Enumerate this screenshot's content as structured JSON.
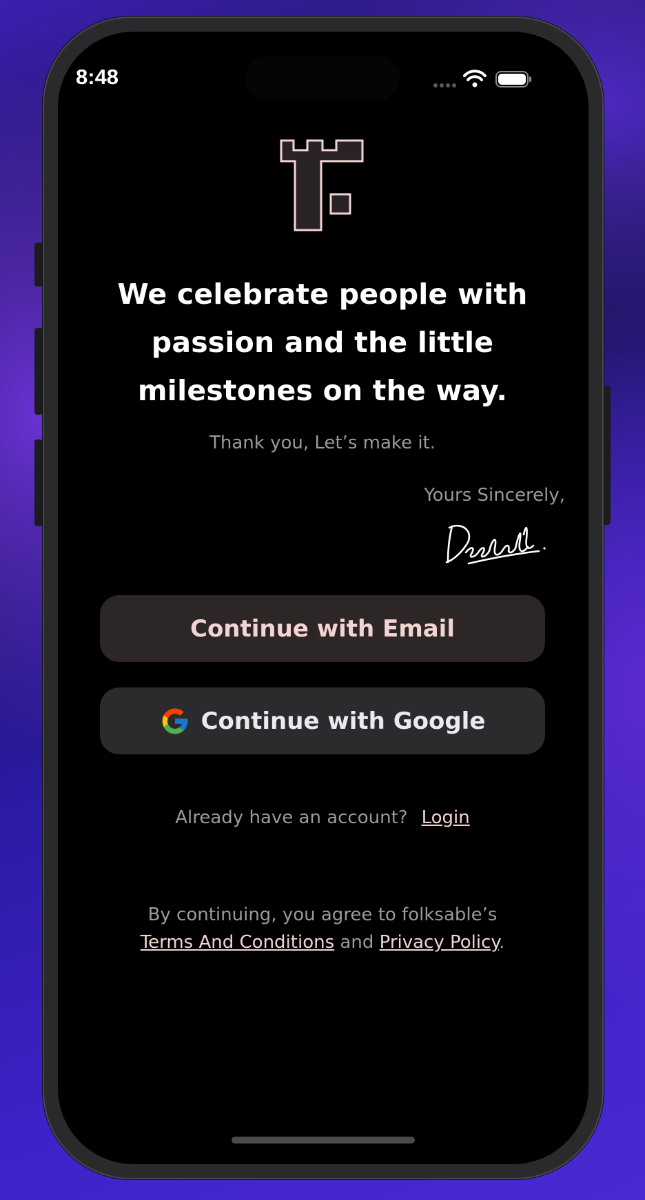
{
  "status_bar": {
    "time": "8:48",
    "icons": [
      "signal-icon",
      "wifi-icon",
      "battery-icon"
    ]
  },
  "brand": {
    "logo_icon": "folksable-logo-icon",
    "logo_stroke_color": "#f2d4d2",
    "logo_fill_color": "#2a2325"
  },
  "headline": {
    "line1": "We celebrate people with",
    "line2": "passion and the little",
    "line3": "milestones on the way."
  },
  "subtitle": "Thank you, Let’s make it.",
  "signoff": "Yours Sincerely,",
  "signature_icon": "handwritten-signature",
  "buttons": {
    "email_label": "Continue with Email",
    "google_label": "Continue with Google",
    "google_icon": "google-icon"
  },
  "login_prompt": {
    "text": "Already have an account?",
    "link": "Login"
  },
  "legal": {
    "intro": "By continuing, you agree to folksable’s",
    "terms": "Terms And Conditions",
    "and": "and",
    "privacy": "Privacy Policy",
    "period": "."
  },
  "colors": {
    "accent_pink": "#f2d4d2",
    "muted_text": "#9a9a9a",
    "screen_bg": "#000000",
    "email_button_bg": "#2c2627",
    "google_button_bg": "#2b2b2d"
  }
}
